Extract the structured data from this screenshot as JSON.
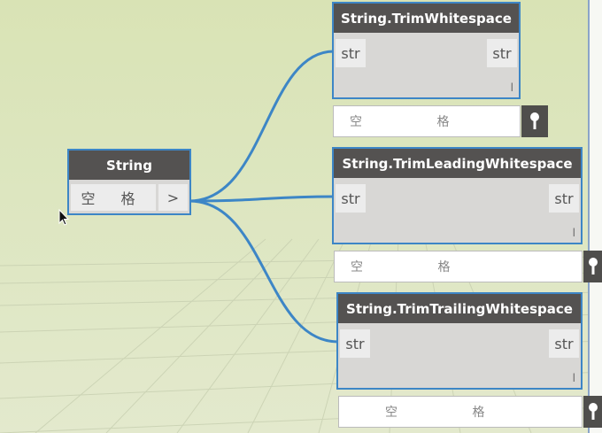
{
  "string_node": {
    "title": "String",
    "value": "空 格",
    "output_port": ">"
  },
  "nodes": [
    {
      "title": "String.TrimWhitespace",
      "input": "str",
      "output": "str",
      "lacing": "l",
      "preview": "空 格"
    },
    {
      "title": "String.TrimLeadingWhitespace",
      "input": "str",
      "output": "str",
      "lacing": "l",
      "preview": "空 格"
    },
    {
      "title": "String.TrimTrailingWhitespace",
      "input": "str",
      "output": "str",
      "lacing": "l",
      "preview": "空 格"
    }
  ],
  "colors": {
    "wire": "#3d86c6",
    "node_header": "#545251",
    "node_border": "#3d86c6",
    "canvas": "#dde6c0"
  },
  "icons": {
    "pin": "pin-icon",
    "cursor": "mouse-cursor-icon"
  }
}
